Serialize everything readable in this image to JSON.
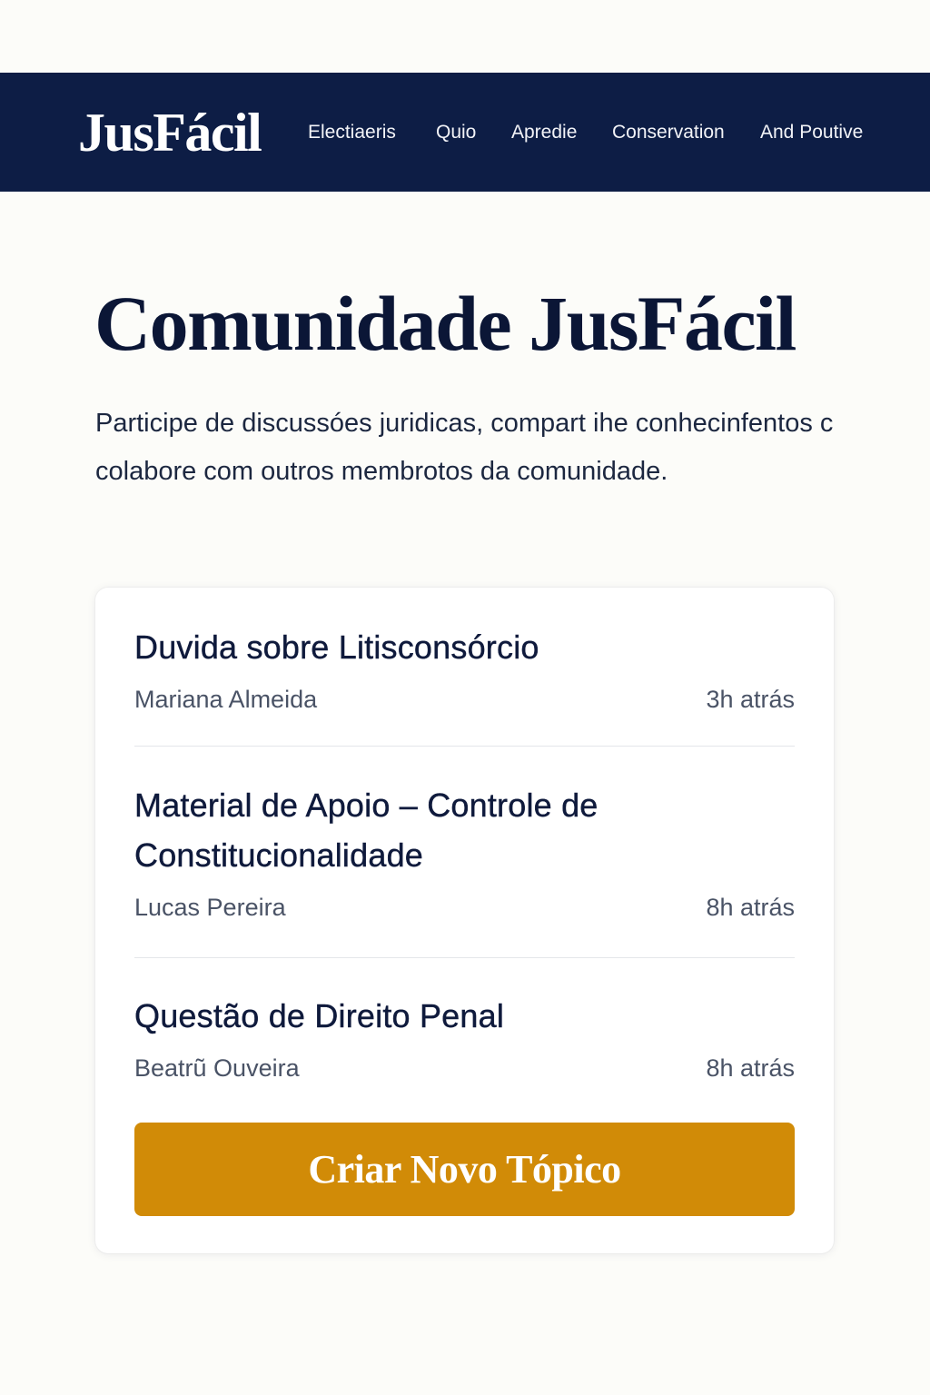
{
  "header": {
    "logo": "JusFácil",
    "nav": [
      {
        "label": "Electiaeris"
      },
      {
        "label": "Quio"
      },
      {
        "label": "Apredie"
      },
      {
        "label": "Conservation"
      },
      {
        "label": "And Poutive"
      }
    ]
  },
  "main": {
    "title": "Comunidade JusFácil",
    "intro": "Participe de discussóes juridicas, compart ihe conhecinfentos c colabore com outros membrotos da comunidade.",
    "topics": [
      {
        "title": "Duvida sobre Litisconsórcio",
        "author": "Mariana Almeida",
        "time": "3h atrás"
      },
      {
        "title": "Material de Apoio – Controle de Constitucionalidade",
        "author": "Lucas Pereira",
        "time": "8h atrás"
      },
      {
        "title": "Questão de Direito Penal",
        "author": "Beatrũ Ouveira",
        "time": "8h atrás"
      }
    ],
    "create_button": "Criar Novo Tópico"
  },
  "colors": {
    "navbar": "#0d1d45",
    "background": "#fcfcf9",
    "accent": "#d18b07",
    "card": "#ffffff"
  }
}
